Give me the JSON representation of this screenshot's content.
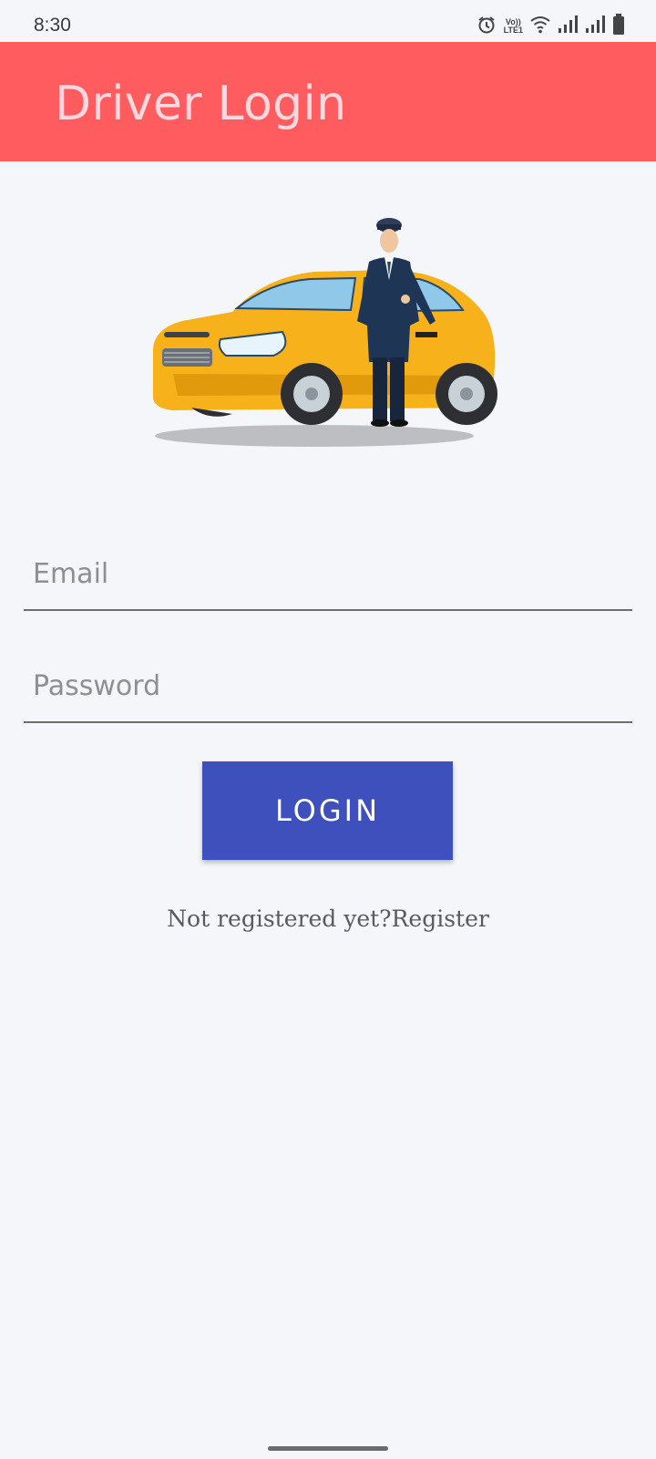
{
  "status_bar": {
    "time": "8:30",
    "volte_top": "Vo))",
    "volte_bottom": "LTE1",
    "icons": [
      "alarm-icon",
      "volte-icon",
      "wifi-icon",
      "signal-icon",
      "signal-icon",
      "battery-icon"
    ]
  },
  "app_bar": {
    "title": "Driver Login",
    "color": "#ff5c5f"
  },
  "illustration": {
    "name": "taxi-driver-illustration",
    "car_color": "#f7b21b"
  },
  "form": {
    "email_placeholder": "Email",
    "email_value": "",
    "password_placeholder": "Password",
    "password_value": ""
  },
  "login_button": {
    "label": "LOGIN",
    "color": "#3d50bb"
  },
  "register_link": {
    "text": "Not registered yet?Register"
  }
}
